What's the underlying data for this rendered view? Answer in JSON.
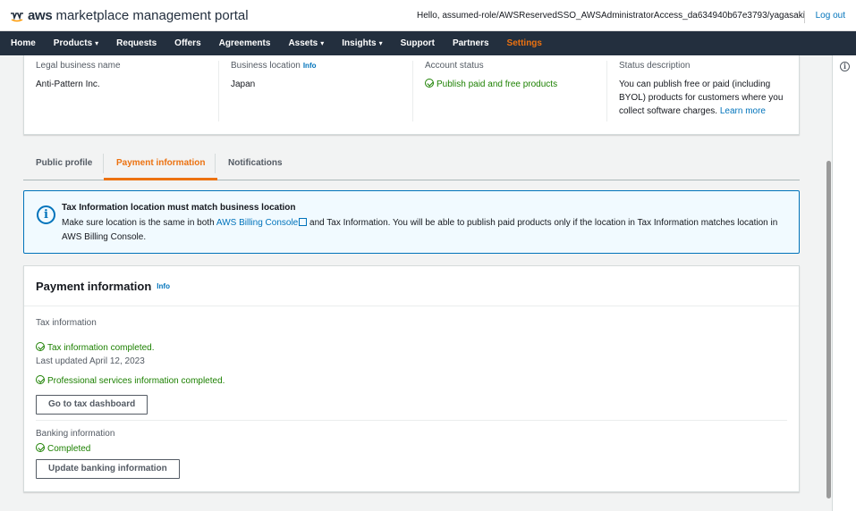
{
  "header": {
    "logo_aws": "aws",
    "logo_rest": "marketplace management portal",
    "hello": "Hello, assumed-role/AWSReservedSSO_AWSAdministratorAccess_da634940b67e3793/yagasaki",
    "logout": "Log out"
  },
  "nav": {
    "home": "Home",
    "products": "Products",
    "requests": "Requests",
    "offers": "Offers",
    "agreements": "Agreements",
    "assets": "Assets",
    "insights": "Insights",
    "support": "Support",
    "partners": "Partners",
    "settings": "Settings"
  },
  "summary": {
    "legal_name_label": "Legal business name",
    "legal_name_value": "Anti-Pattern Inc.",
    "location_label": "Business location",
    "location_info": "Info",
    "location_value": "Japan",
    "status_label": "Account status",
    "status_value": "Publish paid and free products",
    "description_label": "Status description",
    "description_line1": "You can publish free or paid (including",
    "description_line2": "BYOL) products for customers where you",
    "description_line3": "collect software charges.",
    "learn_more": "Learn more"
  },
  "tabs": {
    "public_profile": "Public profile",
    "payment_information": "Payment information",
    "notifications": "Notifications"
  },
  "alert": {
    "title": "Tax Information location must match business location",
    "body_part1": "Make sure location is the same in both",
    "billing_link": "AWS Billing Console",
    "body_part2": "and Tax Information. You will be able to publish paid products only if the location in Tax Information matches location in",
    "body_part3": "AWS Billing Console."
  },
  "panel": {
    "title": "Payment information",
    "info": "Info",
    "tax_label": "Tax information",
    "tax_status": "Tax information completed.",
    "tax_updated": "Last updated April 12, 2023",
    "pro_services_status": "Professional services information completed.",
    "tax_button": "Go to tax dashboard",
    "banking_label": "Banking information",
    "banking_status": "Completed",
    "banking_button": "Update banking information"
  },
  "colors": {
    "nav_bg": "#232f3e",
    "accent_orange": "#ec7211",
    "link_blue": "#0073bb",
    "success_green": "#1d8102"
  },
  "icons": [
    "smile-arrow-logo-icon",
    "info-icon",
    "check-circle-icon",
    "external-link-icon",
    "chevron-down-icon"
  ]
}
